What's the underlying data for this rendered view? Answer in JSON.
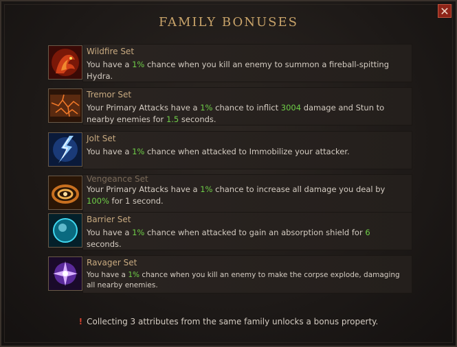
{
  "header": {
    "title": "FAMILY BONUSES",
    "close_label": "✕"
  },
  "sets": [
    {
      "name": "Wildfire Set",
      "icon": "hydra-icon",
      "desc": [
        {
          "t": "You have a "
        },
        {
          "t": "1%",
          "g": true
        },
        {
          "t": " chance when you kill an enemy to summon a fireball-spitting Hydra."
        }
      ]
    },
    {
      "name": "Tremor Set",
      "icon": "cracked-ground-icon",
      "desc": [
        {
          "t": "Your Primary Attacks have a "
        },
        {
          "t": "1%",
          "g": true
        },
        {
          "t": " chance to inflict "
        },
        {
          "t": "3004",
          "g": true
        },
        {
          "t": " damage and Stun to nearby enemies for "
        },
        {
          "t": "1.5",
          "g": true
        },
        {
          "t": " seconds."
        }
      ]
    },
    {
      "name": "Jolt Set",
      "icon": "lightning-icon",
      "desc": [
        {
          "t": "You have a "
        },
        {
          "t": "1%",
          "g": true
        },
        {
          "t": " chance when attacked to Immobilize your attacker."
        }
      ]
    },
    {
      "name": "Vengeance Set",
      "icon": "vortex-icon",
      "desc": [
        {
          "t": "Your Primary Attacks have a "
        },
        {
          "t": "1%",
          "g": true
        },
        {
          "t": " chance to increase all damage you deal by "
        },
        {
          "t": "100%",
          "g": true
        },
        {
          "t": " for 1 second."
        }
      ]
    },
    {
      "name": "Barrier Set",
      "icon": "shield-orb-icon",
      "desc": [
        {
          "t": "You have a "
        },
        {
          "t": "1%",
          "g": true
        },
        {
          "t": " chance when attacked to gain an absorption shield for "
        },
        {
          "t": "6",
          "g": true
        },
        {
          "t": " seconds."
        }
      ]
    },
    {
      "name": "Ravager Set",
      "icon": "explosion-icon",
      "desc": [
        {
          "t": "You have a "
        },
        {
          "t": "1%",
          "g": true
        },
        {
          "t": " chance when you kill an enemy to make the corpse explode, damaging all nearby enemies."
        }
      ]
    }
  ],
  "footer": {
    "mark": "!",
    "text": "Collecting 3 attributes from the same family unlocks a bonus property."
  }
}
